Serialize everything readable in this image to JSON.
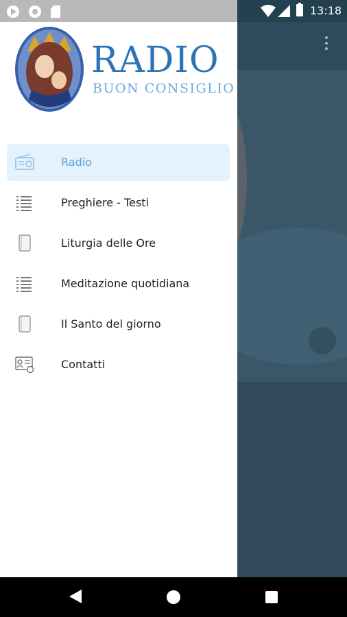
{
  "status_bar": {
    "time": "13:18"
  },
  "logo": {
    "title": "RADIO",
    "subtitle": "BUON CONSIGLIO"
  },
  "menu": {
    "items": [
      {
        "label": "Radio",
        "icon": "radio-icon",
        "active": true
      },
      {
        "label": "Preghiere - Testi",
        "icon": "list-icon"
      },
      {
        "label": "Liturgia delle Ore",
        "icon": "book-icon"
      },
      {
        "label": "Meditazione quotidiana",
        "icon": "list-icon"
      },
      {
        "label": "Il Santo del giorno",
        "icon": "book-icon"
      },
      {
        "label": "Contatti",
        "icon": "contact-card-icon"
      }
    ]
  },
  "colors": {
    "accent": "#5a9fd6",
    "active_bg": "#e3f2fd",
    "logo_blue": "#2c74b5",
    "app_background": "#2f4a5a"
  }
}
